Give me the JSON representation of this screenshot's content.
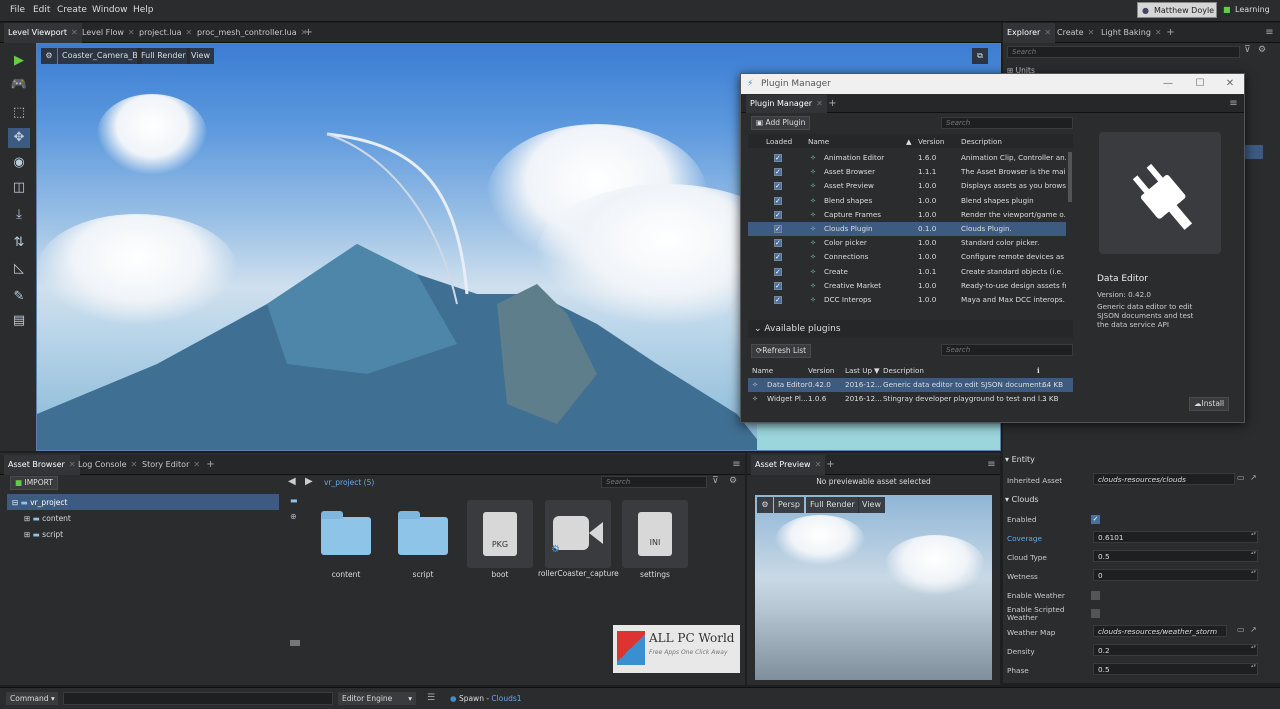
{
  "menu": [
    "File",
    "Edit",
    "Create",
    "Window",
    "Help"
  ],
  "user": "Matthew Doyle",
  "learning": "Learning",
  "top_tabs": [
    "Level Viewport",
    "Level Flow",
    "project.lua",
    "proc_mesh_controller.lua"
  ],
  "viewport": {
    "camera": "Coaster_Camera_B",
    "render": "Full Render",
    "view": "View"
  },
  "right_tabs": [
    "Explorer",
    "Create",
    "Light Baking"
  ],
  "explorer": {
    "search": "Search",
    "first_item": "Units"
  },
  "plugin_manager": {
    "title": "Plugin Manager",
    "tab": "Plugin Manager",
    "add_plugin": "Add Plugin",
    "search": "Search",
    "columns": [
      "Loaded",
      "Name",
      "Version",
      "Description"
    ],
    "rows": [
      {
        "name": "Animation Editor",
        "version": "1.6.0",
        "desc": "Animation Clip, Controller an..."
      },
      {
        "name": "Asset Browser",
        "version": "1.1.1",
        "desc": "The Asset Browser is the mai..."
      },
      {
        "name": "Asset Preview",
        "version": "1.0.0",
        "desc": "Displays assets as you brows..."
      },
      {
        "name": "Blend shapes",
        "version": "1.0.0",
        "desc": "Blend shapes plugin"
      },
      {
        "name": "Capture Frames",
        "version": "1.0.0",
        "desc": "Render the viewport/game o..."
      },
      {
        "name": "Clouds Plugin",
        "version": "0.1.0",
        "desc": "Clouds Plugin."
      },
      {
        "name": "Color picker",
        "version": "1.0.0",
        "desc": "Standard color picker."
      },
      {
        "name": "Connections",
        "version": "1.0.0",
        "desc": "Configure remote devices as ..."
      },
      {
        "name": "Create",
        "version": "1.0.1",
        "desc": "Create standard objects (i.e. L..."
      },
      {
        "name": "Creative Market",
        "version": "1.0.0",
        "desc": "Ready-to-use design assets fr..."
      },
      {
        "name": "DCC Interops",
        "version": "1.0.0",
        "desc": "Maya and Max DCC interops."
      }
    ],
    "available_title": "Available plugins",
    "refresh": "Refresh List",
    "search2": "Search",
    "avail_columns": [
      "Name",
      "Version",
      "Last Up",
      "Description"
    ],
    "avail_rows": [
      {
        "name": "Data Editor",
        "version": "0.42.0",
        "date": "2016-12...",
        "desc": "Generic data editor to edit SJSON document...",
        "size": "64 KB"
      },
      {
        "name": "Widget Pl...",
        "version": "1.0.6",
        "date": "2016-12...",
        "desc": "Stingray developer playground to test and l...",
        "size": "3 KB"
      }
    ],
    "detail": {
      "title": "Data Editor",
      "version": "Version: 0.42.0",
      "desc": "Generic data editor to edit SJSON documents and test the data service API",
      "install": "Install"
    }
  },
  "bottom_tabs": [
    "Asset Browser",
    "Log Console",
    "Story Editor"
  ],
  "asset_browser": {
    "import": "IMPORT",
    "tree": [
      "vr_project",
      "content",
      "script"
    ],
    "path": "vr_project (5)",
    "search": "Search",
    "assets": [
      {
        "label": "content",
        "kind": "folder"
      },
      {
        "label": "script",
        "kind": "folder"
      },
      {
        "label": "boot",
        "kind": "PKG"
      },
      {
        "label": "rollerCoaster_capture",
        "kind": "camera"
      },
      {
        "label": "settings",
        "kind": "INI"
      }
    ],
    "watermark_title": "ALL PC World",
    "watermark_sub": "Free Apps One Click Away"
  },
  "asset_preview": {
    "tab": "Asset Preview",
    "message": "No previewable asset selected",
    "persp": "Persp",
    "render": "Full Render",
    "view": "View"
  },
  "properties": {
    "entity": "Entity",
    "inherited_label": "Inherited Asset",
    "inherited_value": "clouds-resources/clouds",
    "clouds": "Clouds",
    "items": [
      {
        "label": "Enabled",
        "type": "check"
      },
      {
        "label": "Coverage",
        "value": "0.6101"
      },
      {
        "label": "Cloud Type",
        "value": "0.5"
      },
      {
        "label": "Wetness",
        "value": "0"
      },
      {
        "label": "Enable Weather",
        "type": "check_off"
      },
      {
        "label": "Enable Scripted Weather",
        "type": "check_off"
      },
      {
        "label": "Weather Map",
        "value": "clouds-resources/weather_storm"
      },
      {
        "label": "Density",
        "value": "0.2"
      },
      {
        "label": "Phase",
        "value": "0.5"
      }
    ]
  },
  "status": {
    "command": "Command",
    "engine": "Editor Engine",
    "msg_prefix": "Spawn - ",
    "msg_link": "Clouds1"
  }
}
